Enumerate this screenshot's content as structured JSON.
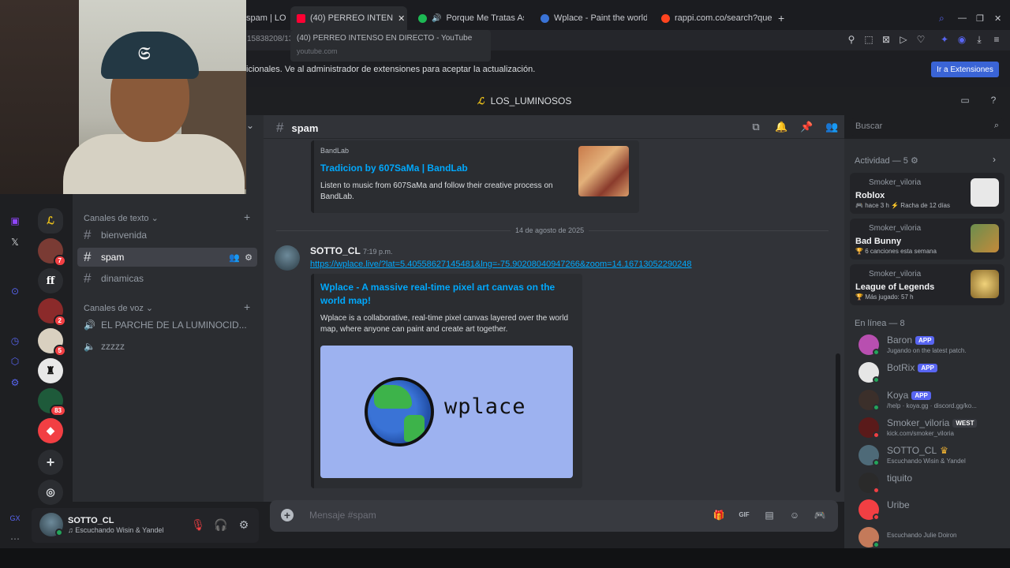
{
  "browser": {
    "tabs": [
      {
        "label": "spam | LO",
        "favicon_color": "#5865f2"
      },
      {
        "label": "(40) PERREO INTEN",
        "favicon_color": "#ff0033"
      },
      {
        "label": "Porque Me Tratas Así",
        "favicon_color": "#1db954"
      },
      {
        "label": "Wplace - Paint the world",
        "favicon_color": "#3a73d6"
      },
      {
        "label": "rappi.com.co/search?que",
        "favicon_color": "#ff441f"
      }
    ],
    "tooltip_title": "(40) PERREO INTENSO EN DIRECTO - YouTube",
    "tooltip_url": "youtube.com",
    "address": "15838208/13",
    "notice_text": "icionales. Ve al administrador de extensiones para aceptar la actualización.",
    "notice_button": "Ir a Extensiones"
  },
  "server": {
    "name": "LOS_LUMINOSOS",
    "logo": "✡"
  },
  "guild_badges": [
    "7",
    "2",
    "5",
    "83"
  ],
  "channels": {
    "text_category": "Canales de texto",
    "voice_category": "Canales de voz",
    "text": [
      "bienvenida",
      "spam",
      "dinamicas"
    ],
    "voice": [
      "EL PARCHE DE LA LUMINOCID...",
      "zzzzz"
    ],
    "active": "spam"
  },
  "chat": {
    "channel": "spam",
    "search_placeholder": "Buscar",
    "embed1": {
      "provider": "BandLab",
      "title": "Tradicion  by 607SaMa | BandLab",
      "description": "Listen to music from 607SaMa and follow their creative process on BandLab."
    },
    "date_divider": "14 de agosto de 2025",
    "message": {
      "author": "SOTTO_CL",
      "time": "7:19 p.m.",
      "link": "https://wplace.live/?lat=5.40558627145481&lng=-75.90208040947266&zoom=14.16713052290248"
    },
    "embed2": {
      "title": "Wplace - A massive real-time pixel art canvas on the world map!",
      "description": "Wplace is a collaborative, real-time pixel canvas layered over the world map, where anyone can paint and create art together.",
      "image_word": "wplace"
    },
    "composer_placeholder": "Mensaje #spam"
  },
  "activity": {
    "header": "Actividad — 5",
    "items": [
      {
        "user": "Smoker_viloria",
        "game": "Roblox",
        "sub": "hace 3 h  ⚡ Racha de 12 días",
        "art_color": "#e8e8e8"
      },
      {
        "user": "Smoker_viloria",
        "game": "Bad Bunny",
        "sub": "6 canciones esta semana",
        "art_color": "#6b8e4e"
      },
      {
        "user": "Smoker_viloria",
        "game": "League of Legends",
        "sub": "Más jugado: 57 h",
        "art_color": "#c8aa6e"
      }
    ]
  },
  "online": {
    "header": "En línea — 8",
    "members": [
      {
        "name": "Baron",
        "tag": "APP",
        "status": "Jugando on the latest patch.",
        "avatar_color": "#b84fb0",
        "dot_color": "#23a55a"
      },
      {
        "name": "BotRix",
        "tag": "APP",
        "status": "",
        "avatar_color": "#e6e6e6",
        "dot_color": "#23a55a"
      },
      {
        "name": "Koya",
        "tag": "APP",
        "status": "/help · koya.gg · discord.gg/ko...",
        "avatar_color": "#3b2f2a",
        "dot_color": "#23a55a"
      },
      {
        "name": "Smoker_viloria",
        "tag": "WEST",
        "status": "kick.com/smoker_viloria",
        "avatar_color": "#5a1a1a",
        "dot_color": "#f23f43"
      },
      {
        "name": "SOTTO_CL",
        "tag": "♛",
        "status": "Escuchando Wisin & Yandel",
        "avatar_color": "#4e6a78",
        "dot_color": "#23a55a"
      },
      {
        "name": "tiquito",
        "tag": "",
        "status": "",
        "avatar_color": "#2a2a2a",
        "dot_color": "#f23f43"
      },
      {
        "name": "Uribe",
        "tag": "",
        "status": "",
        "avatar_color": "#f23f43",
        "dot_color": "#f23f43"
      },
      {
        "name": "",
        "tag": "",
        "status": "Escuchando Julie Doiron",
        "avatar_color": "#c47a5a",
        "dot_color": "#23a55a"
      }
    ]
  },
  "user_panel": {
    "name": "SOTTO_CL",
    "status": "Escuchando Wisin & Yandel"
  },
  "rail_labels": {
    "gx": "GX"
  }
}
